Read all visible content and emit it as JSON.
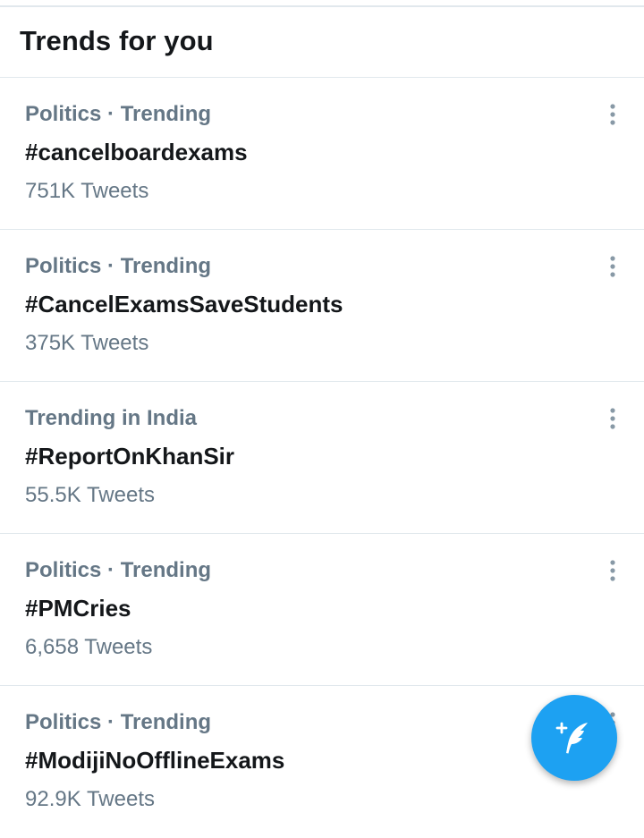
{
  "header": {
    "title": "Trends for you"
  },
  "trends": [
    {
      "context": "Politics · Trending",
      "name": "#cancelboardexams",
      "count": "751K Tweets"
    },
    {
      "context": "Politics · Trending",
      "name": "#CancelExamsSaveStudents",
      "count": "375K Tweets"
    },
    {
      "context": "Trending in India",
      "name": "#ReportOnKhanSir",
      "count": "55.5K Tweets"
    },
    {
      "context": "Politics · Trending",
      "name": "#PMCries",
      "count": "6,658 Tweets"
    },
    {
      "context": "Politics · Trending",
      "name": "#ModijiNoOfflineExams",
      "count": "92.9K Tweets"
    }
  ],
  "icons": {
    "more": "more-vertical-icon",
    "compose": "compose-tweet-icon"
  },
  "colors": {
    "accent": "#1da1f2",
    "secondary_text": "#657786",
    "primary_text": "#14171a",
    "divider": "#e1e8ed"
  }
}
